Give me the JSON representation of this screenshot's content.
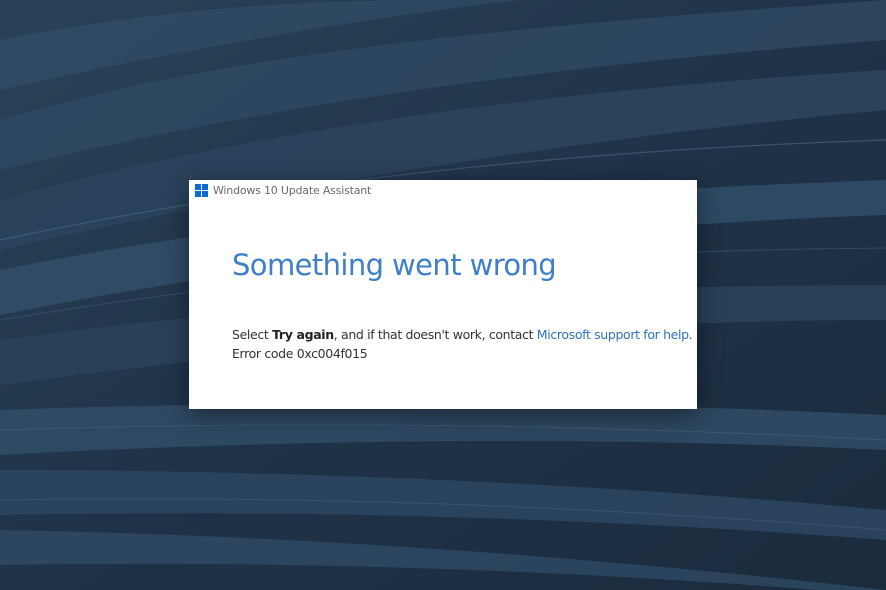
{
  "window": {
    "title": "Windows 10 Update Assistant",
    "app_icon": "windows-logo-icon"
  },
  "dialog": {
    "heading": "Something went wrong",
    "message_prefix": "Select ",
    "message_bold": "Try again",
    "message_middle": ", and if that doesn't work, contact ",
    "support_link": "Microsoft support for help.",
    "error_code": "Error code 0xc004f015"
  },
  "colors": {
    "accent": "#3f7fc7",
    "link": "#2d74c4",
    "background": "#1e3146",
    "logo": "#0a6ad8"
  }
}
